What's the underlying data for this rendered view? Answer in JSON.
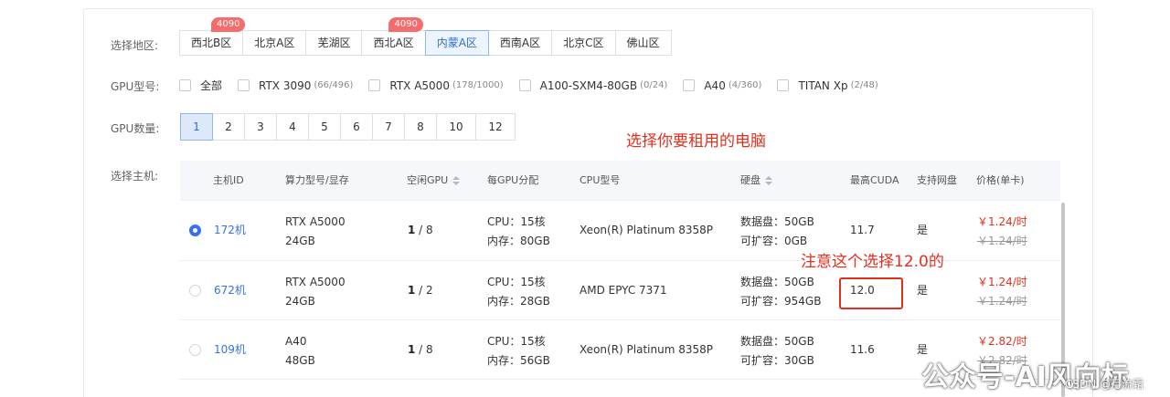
{
  "region": {
    "label": "选择地区:",
    "options": [
      {
        "label": "西北B区",
        "badge": "4090"
      },
      {
        "label": "北京A区",
        "badge": ""
      },
      {
        "label": "芜湖区",
        "badge": ""
      },
      {
        "label": "西北A区",
        "badge": "4090"
      },
      {
        "label": "内蒙A区",
        "badge": ""
      },
      {
        "label": "西南A区",
        "badge": ""
      },
      {
        "label": "北京C区",
        "badge": ""
      },
      {
        "label": "佛山区",
        "badge": ""
      }
    ],
    "selected": "内蒙A区"
  },
  "gpu_type": {
    "label": "GPU型号:",
    "options": [
      {
        "label": "全部",
        "count": ""
      },
      {
        "label": "RTX 3090",
        "count": "(66/496)"
      },
      {
        "label": "RTX A5000",
        "count": "(178/1000)"
      },
      {
        "label": "A100-SXM4-80GB",
        "count": "(0/24)"
      },
      {
        "label": "A40",
        "count": "(4/360)"
      },
      {
        "label": "TITAN Xp",
        "count": "(2/48)"
      }
    ]
  },
  "gpu_count": {
    "label": "GPU数量:",
    "options": [
      "1",
      "2",
      "3",
      "4",
      "5",
      "6",
      "7",
      "8",
      "10",
      "12"
    ],
    "selected": "1"
  },
  "host": {
    "label": "选择主机:",
    "columns": {
      "id": "主机ID",
      "gpu": "算力型号/显存",
      "free": "空闲GPU",
      "per_gpu": "每GPU分配",
      "cpu": "CPU型号",
      "disk": "硬盘",
      "cuda": "最高CUDA",
      "netdisk": "支持网盘",
      "price": "价格(单卡)"
    },
    "rows": [
      {
        "id": "172机",
        "gpu_model": "RTX A5000",
        "gpu_mem": "24GB",
        "free_now": "1",
        "free_total": " / 8",
        "cpu_alloc": "CPU：15核",
        "mem_alloc": "内存：80GB",
        "cpu_model": "Xeon(R) Platinum 8358P",
        "data_disk": "数据盘：50GB",
        "expand_disk": "可扩容：0GB",
        "cuda": "11.7",
        "netdisk": "是",
        "price": "￥1.24/时",
        "price_old": "￥1.24/时",
        "selected": true
      },
      {
        "id": "672机",
        "gpu_model": "RTX A5000",
        "gpu_mem": "24GB",
        "free_now": "1",
        "free_total": " / 2",
        "cpu_alloc": "CPU：15核",
        "mem_alloc": "内存：28GB",
        "cpu_model": "AMD EPYC 7371",
        "data_disk": "数据盘：50GB",
        "expand_disk": "可扩容：954GB",
        "cuda": "12.0",
        "netdisk": "是",
        "price": "￥1.24/时",
        "price_old": "￥1.24/时",
        "selected": false
      },
      {
        "id": "109机",
        "gpu_model": "A40",
        "gpu_mem": "48GB",
        "free_now": "1",
        "free_total": " / 8",
        "cpu_alloc": "CPU：15核",
        "mem_alloc": "内存：56GB",
        "cpu_model": "Xeon(R) Platinum 8358P",
        "data_disk": "数据盘：50GB",
        "expand_disk": "可扩容：30GB",
        "cuda": "11.6",
        "netdisk": "是",
        "price": "￥2.82/时",
        "price_old": "￥2.82/时",
        "selected": false
      }
    ]
  },
  "annotations": {
    "choose_pc": "选择你要租用的电脑",
    "note_cuda": "注意这个选择12.0的"
  },
  "watermark": {
    "main": "公众号-AI风向标",
    "csdn": "CSDN @月流霜"
  },
  "colors": {
    "accent": "#3572e8",
    "annotation_red": "#e0301e",
    "badge_red": "#f56c6c",
    "active_bg": "#ecf5ff"
  }
}
